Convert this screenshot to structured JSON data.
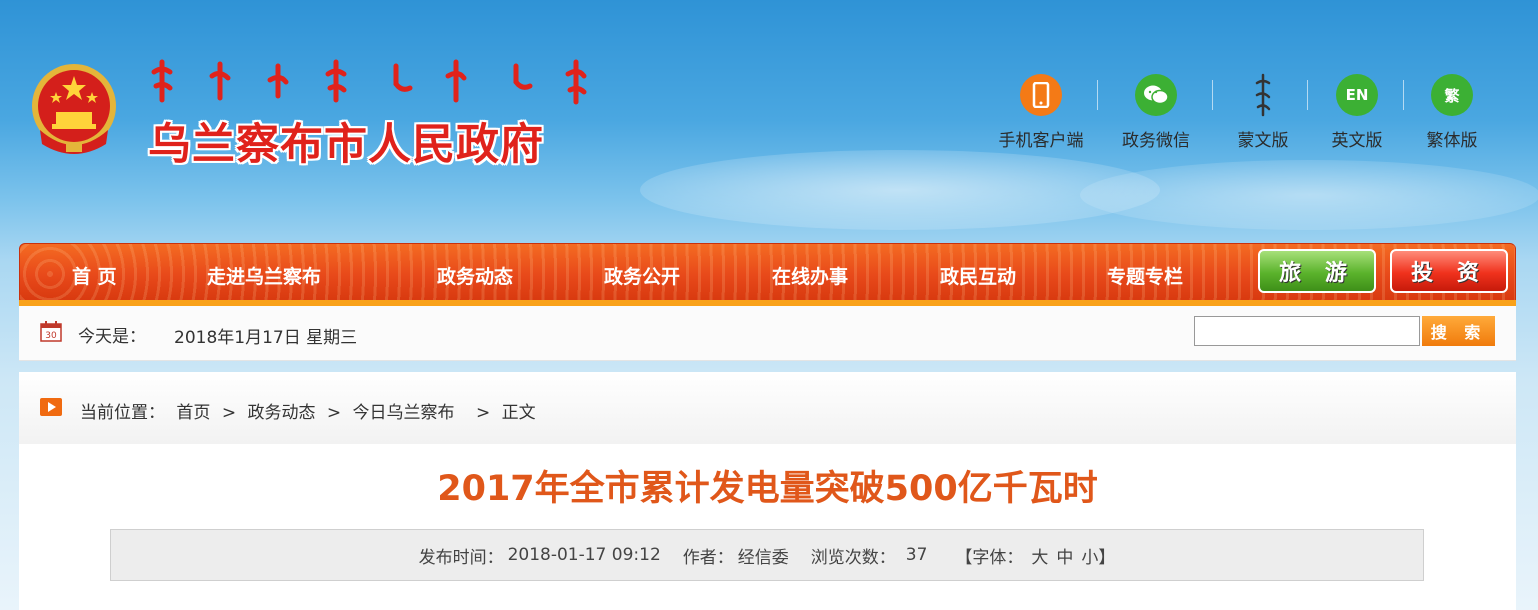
{
  "header": {
    "site_title": "乌兰察布市人民政府",
    "top_links": [
      {
        "label": "手机客户端",
        "icon": "mobile-phone-icon",
        "color": "#f47a16"
      },
      {
        "label": "政务微信",
        "icon": "wechat-icon",
        "color": "#3cb034"
      },
      {
        "label": "蒙文版",
        "icon": "mongolian-script-icon",
        "color": ""
      },
      {
        "label": "英文版",
        "icon": "en-icon",
        "badge": "EN",
        "color": "#3cb034"
      },
      {
        "label": "繁体版",
        "icon": "traditional-chinese-icon",
        "badge": "繁",
        "color": "#3cb034"
      }
    ]
  },
  "nav": {
    "items": [
      "首 页",
      "走进乌兰察布",
      "政务动态",
      "政务公开",
      "在线办事",
      "政民互动",
      "专题专栏"
    ],
    "travel_button": "旅 游",
    "invest_button": "投 资",
    "accent_color": "#e8491a"
  },
  "datebar": {
    "calendar_day": "30",
    "today_label": "今天是：",
    "today_value": "2018年1月17日 星期三",
    "search_value": "",
    "search_button": "搜 索"
  },
  "breadcrumb": {
    "label": "当前位置：",
    "items": [
      "首页",
      ">",
      "政务动态",
      ">",
      "今日乌兰察布",
      ">",
      "正文"
    ]
  },
  "article": {
    "title": "2017年全市累计发电量突破500亿千瓦时",
    "publish_label": "发布时间：",
    "publish_time": "2018-01-17 09:12",
    "author_label": "作者：",
    "author": "经信委",
    "views_label": "浏览次数：",
    "views": "37",
    "font_label": "【字体：",
    "font_large": "大",
    "font_medium": "中",
    "font_small": "小",
    "font_close": "】"
  }
}
